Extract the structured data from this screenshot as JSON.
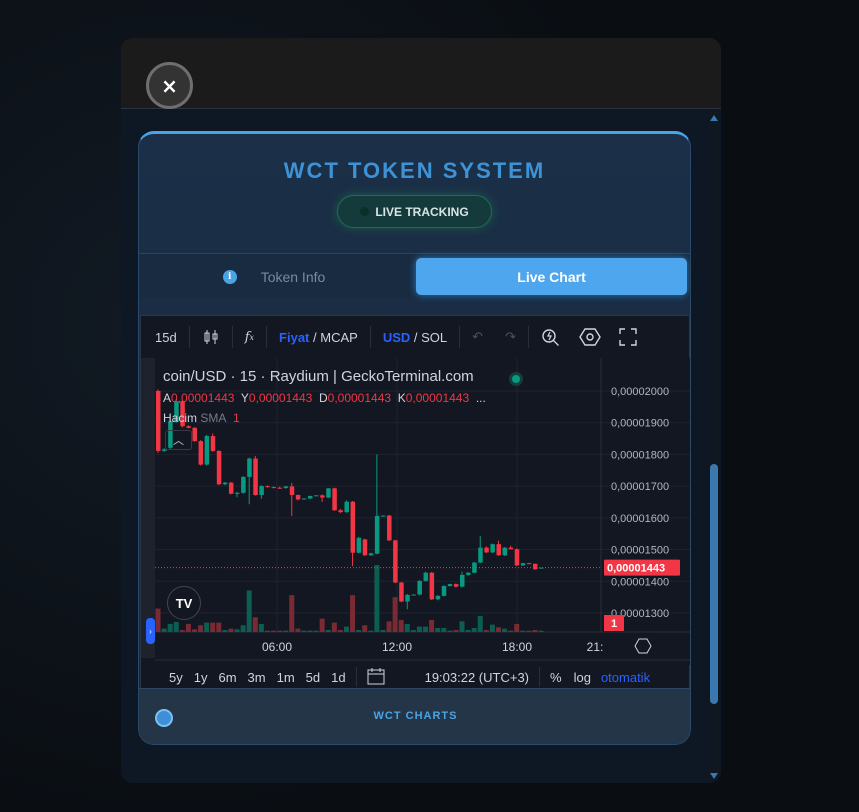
{
  "modal": {
    "close_label": "×"
  },
  "header": {
    "title": "WCT TOKEN SYSTEM",
    "status": "LIVE TRACKING"
  },
  "tabs": [
    {
      "label": "Token Info",
      "active": false
    },
    {
      "label": "Live Chart",
      "active": true
    }
  ],
  "toolbar": {
    "interval": "15d",
    "price_label": "Fiyat",
    "mcap_label": "MCAP",
    "currency_active": "USD",
    "currency_alt": "SOL",
    "slash": "/"
  },
  "chart_header": {
    "symbol": "coin/USD · 15 · Raydium | GeckoTerminal.com",
    "ohlc": [
      {
        "k": "A",
        "v": "0,00001443"
      },
      {
        "k": "Y",
        "v": "0,00001443"
      },
      {
        "k": "D",
        "v": "0,00001443"
      },
      {
        "k": "K",
        "v": "0,00001443"
      }
    ],
    "more": "...",
    "volume_label": "Hacim",
    "volume_sma": "SMA",
    "volume_value": "1"
  },
  "bottom": {
    "ranges": [
      "5y",
      "1y",
      "6m",
      "3m",
      "1m",
      "5d",
      "1d"
    ],
    "clock": "19:03:22 (UTC+3)",
    "percent": "%",
    "log": "log",
    "auto": "otomatik"
  },
  "footer": {
    "label": "WCT CHARTS"
  },
  "colors": {
    "up": "#089981",
    "down": "#f23645",
    "accent": "#4aa3e6"
  },
  "chart_data": {
    "type": "candlestick",
    "price_unit": "1e-8 USD",
    "y_ticks": [
      "0,00002000",
      "0,00001900",
      "0,00001800",
      "0,00001700",
      "0,00001600",
      "0,00001500",
      "0,00001400",
      "0,00001300"
    ],
    "y_tick_values": [
      2000,
      1900,
      1800,
      1700,
      1600,
      1500,
      1400,
      1300
    ],
    "x_ticks": [
      "06:00",
      "12:00",
      "18:00",
      "21:"
    ],
    "x_tick_index": [
      20,
      40,
      60,
      70
    ],
    "last_price_label": "0,00001443",
    "last_price": 1443,
    "volume_axis_label": "1",
    "candles": [
      [
        2000,
        2005,
        1805,
        1811
      ],
      [
        1811,
        1820,
        1808,
        1816
      ],
      [
        1821,
        1910,
        1815,
        1905
      ],
      [
        1905,
        1975,
        1900,
        1968
      ],
      [
        1968,
        1972,
        1885,
        1889
      ],
      [
        1889,
        1892,
        1882,
        1884
      ],
      [
        1884,
        1886,
        1840,
        1842
      ],
      [
        1842,
        1845,
        1765,
        1768
      ],
      [
        1768,
        1862,
        1765,
        1858
      ],
      [
        1858,
        1866,
        1808,
        1811
      ],
      [
        1811,
        1813,
        1703,
        1706
      ],
      [
        1706,
        1713,
        1703,
        1711
      ],
      [
        1711,
        1713,
        1674,
        1676
      ],
      [
        1676,
        1682,
        1665,
        1679
      ],
      [
        1679,
        1732,
        1676,
        1729
      ],
      [
        1729,
        1790,
        1643,
        1787
      ],
      [
        1787,
        1795,
        1670,
        1672
      ],
      [
        1672,
        1703,
        1660,
        1700
      ],
      [
        1700,
        1702,
        1695,
        1697
      ],
      [
        1697,
        1699,
        1693,
        1695
      ],
      [
        1695,
        1698,
        1692,
        1694
      ],
      [
        1694,
        1701,
        1692,
        1699
      ],
      [
        1699,
        1710,
        1606,
        1672
      ],
      [
        1672,
        1674,
        1655,
        1658
      ],
      [
        1658,
        1662,
        1657,
        1661
      ],
      [
        1661,
        1670,
        1659,
        1669
      ],
      [
        1669,
        1672,
        1668,
        1671
      ],
      [
        1671,
        1674,
        1650,
        1664
      ],
      [
        1664,
        1694,
        1662,
        1693
      ],
      [
        1693,
        1695,
        1622,
        1624
      ],
      [
        1624,
        1628,
        1615,
        1618
      ],
      [
        1618,
        1655,
        1616,
        1651
      ],
      [
        1651,
        1653,
        1448,
        1490
      ],
      [
        1490,
        1540,
        1488,
        1537
      ],
      [
        1532,
        1534,
        1480,
        1482
      ],
      [
        1482,
        1490,
        1480,
        1488
      ],
      [
        1487,
        1800,
        1485,
        1606
      ],
      [
        1606,
        1608,
        1604,
        1607
      ],
      [
        1607,
        1609,
        1527,
        1529
      ],
      [
        1529,
        1531,
        1394,
        1396
      ],
      [
        1396,
        1398,
        1334,
        1336
      ],
      [
        1336,
        1360,
        1312,
        1357
      ],
      [
        1357,
        1359,
        1355,
        1358
      ],
      [
        1358,
        1404,
        1356,
        1401
      ],
      [
        1401,
        1430,
        1399,
        1427
      ],
      [
        1427,
        1429,
        1341,
        1343
      ],
      [
        1343,
        1356,
        1340,
        1354
      ],
      [
        1354,
        1387,
        1352,
        1385
      ],
      [
        1385,
        1392,
        1383,
        1391
      ],
      [
        1391,
        1393,
        1380,
        1383
      ],
      [
        1383,
        1430,
        1381,
        1420
      ],
      [
        1420,
        1429,
        1418,
        1427
      ],
      [
        1427,
        1461,
        1425,
        1459
      ],
      [
        1459,
        1543,
        1457,
        1506
      ],
      [
        1506,
        1510,
        1489,
        1491
      ],
      [
        1491,
        1519,
        1489,
        1517
      ],
      [
        1517,
        1528,
        1480,
        1482
      ],
      [
        1482,
        1508,
        1480,
        1506
      ],
      [
        1506,
        1512,
        1500,
        1501
      ],
      [
        1501,
        1504,
        1448,
        1450
      ],
      [
        1450,
        1458,
        1448,
        1457
      ],
      [
        1457,
        1458,
        1454,
        1455
      ],
      [
        1455,
        1456,
        1436,
        1438
      ],
      [
        1443,
        1443,
        1443,
        1443
      ]
    ],
    "volume": [
      35,
      5,
      12,
      15,
      3,
      12,
      4,
      10,
      14,
      14,
      14,
      3,
      5,
      4,
      10,
      62,
      22,
      12,
      2,
      2,
      2,
      2,
      55,
      5,
      2,
      2,
      2,
      20,
      3,
      14,
      3,
      8,
      55,
      3,
      10,
      2,
      100,
      3,
      16,
      52,
      18,
      12,
      3,
      8,
      8,
      18,
      6,
      6,
      2,
      3,
      16,
      3,
      6,
      24,
      3,
      11,
      7,
      5,
      2,
      12,
      2,
      2,
      3,
      2
    ]
  }
}
